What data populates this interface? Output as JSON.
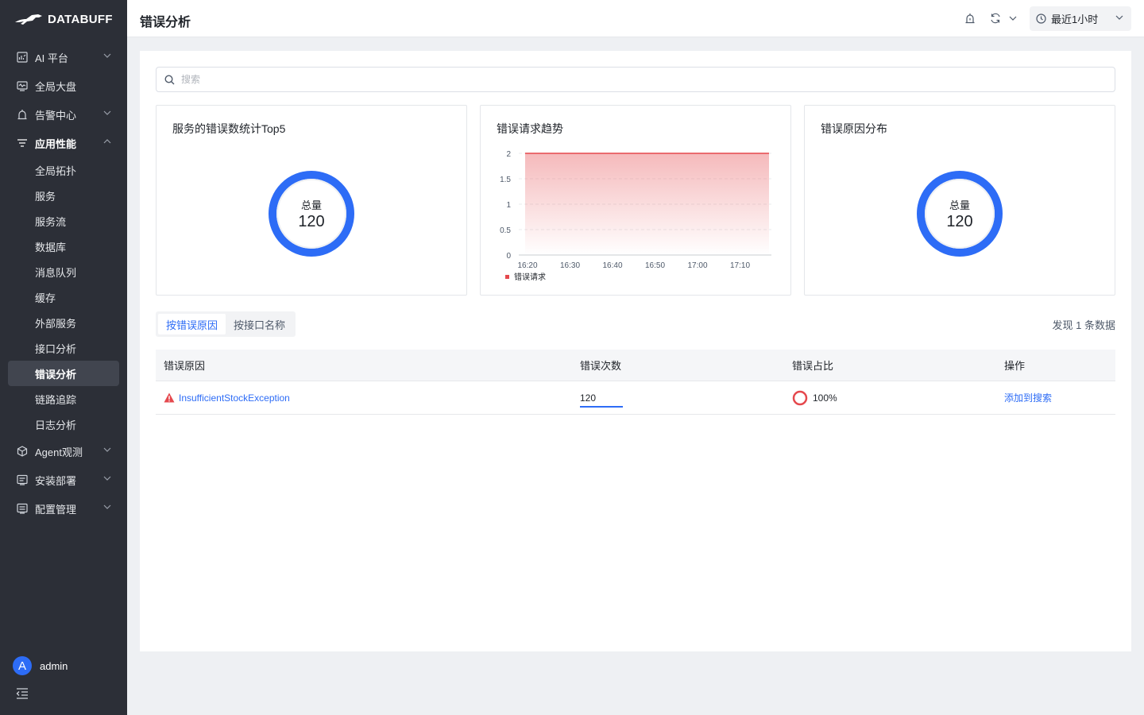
{
  "brand": {
    "name": "DATABUFF"
  },
  "nav": {
    "items": [
      {
        "label": "AI 平台",
        "icon": "ai-chart-icon",
        "chevron": "down"
      },
      {
        "label": "全局大盘",
        "icon": "monitor-icon"
      },
      {
        "label": "告警中心",
        "icon": "alarm-icon",
        "chevron": "down"
      },
      {
        "label": "应用性能",
        "icon": "filter-lines-icon",
        "chevron": "up",
        "expanded": true
      }
    ],
    "sub_items": [
      "全局拓扑",
      "服务",
      "服务流",
      "数据库",
      "消息队列",
      "缓存",
      "外部服务",
      "接口分析",
      "错误分析",
      "链路追踪",
      "日志分析"
    ],
    "active_sub": "错误分析",
    "bottom_items": [
      {
        "label": "Agent观测",
        "icon": "cube-icon",
        "chevron": "down"
      },
      {
        "label": "安装部署",
        "icon": "document-icon",
        "chevron": "down"
      },
      {
        "label": "配置管理",
        "icon": "settings-doc-icon",
        "chevron": "down"
      }
    ]
  },
  "user": {
    "initial": "A",
    "name": "admin"
  },
  "header": {
    "title": "错误分析",
    "time_range": "最近1小时"
  },
  "search": {
    "placeholder": "搜索"
  },
  "cards": {
    "top5": {
      "title": "服务的错误数统计Top5",
      "total_label": "总量",
      "total_value": "120"
    },
    "trend": {
      "title": "错误请求趋势"
    },
    "cause": {
      "title": "错误原因分布",
      "total_label": "总量",
      "total_value": "120"
    }
  },
  "chart_data": {
    "type": "area",
    "title": "错误请求趋势",
    "x": [
      "16:15",
      "17:15"
    ],
    "x_ticks": [
      "16:20",
      "16:30",
      "16:40",
      "16:50",
      "17:00",
      "17:10"
    ],
    "y_ticks": [
      "0",
      "0.5",
      "1",
      "1.5",
      "2"
    ],
    "ylim": [
      0,
      2
    ],
    "series": [
      {
        "name": "错误请求",
        "values": [
          2,
          2
        ],
        "color": "#e5484d"
      }
    ],
    "legend": "bottom-left",
    "grid": true
  },
  "tabs": [
    "按错误原因",
    "按接口名称"
  ],
  "active_tab": "按错误原因",
  "found_text": "发现 1 条数据",
  "table": {
    "columns": [
      "错误原因",
      "错误次数",
      "错误占比",
      "操作"
    ],
    "rows": [
      {
        "cause": "InsufficientStockException",
        "count": "120",
        "count_fraction": 1.0,
        "percent": "100%",
        "action": "添加到搜索"
      }
    ]
  },
  "colors": {
    "accent": "#2d6cf6",
    "error": "#e5484d",
    "sidebar": "#2c2f37"
  }
}
